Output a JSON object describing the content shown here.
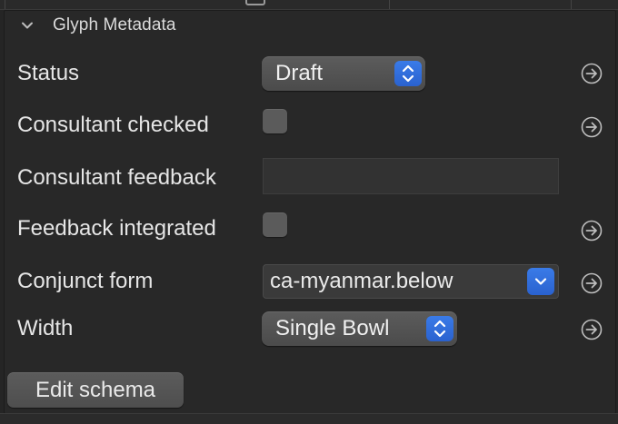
{
  "section": {
    "title": "Glyph Metadata",
    "expanded": true
  },
  "fields": {
    "status": {
      "label": "Status",
      "value": "Draft",
      "control": "popup-button"
    },
    "consultant_checked": {
      "label": "Consultant checked",
      "checked": false
    },
    "consultant_feedback": {
      "label": "Consultant feedback",
      "value": ""
    },
    "feedback_integrated": {
      "label": "Feedback integrated",
      "checked": false
    },
    "conjunct_form": {
      "label": "Conjunct form",
      "value": "ca-myanmar.below",
      "control": "combo-box"
    },
    "width": {
      "label": "Width",
      "value": "Single Bowl",
      "control": "popup-button"
    }
  },
  "actions": {
    "edit_schema_label": "Edit schema"
  },
  "icons": {
    "section_toggle": "chevron-down-icon",
    "row_action": "arrow-right-circle-icon",
    "popup_indicator": "up-down-chevron-icon",
    "combo_indicator": "chevron-down-icon"
  },
  "colors": {
    "background": "#282828",
    "accent": "#2f6ddb",
    "text": "#e6e6e6",
    "control": "#555555"
  }
}
